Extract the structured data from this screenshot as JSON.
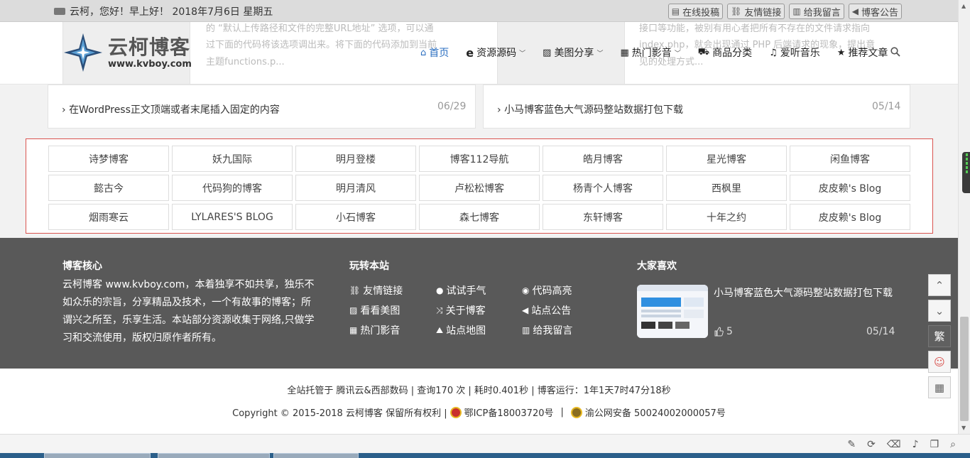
{
  "topbar": {
    "greeting": "云柯，您好！早上好！ 2018年7月6日 星期五",
    "links": [
      {
        "icon": "edit-icon",
        "glyph": "▤",
        "label": "在线投稿"
      },
      {
        "icon": "link-icon",
        "glyph": "⛓",
        "label": "友情链接"
      },
      {
        "icon": "book-icon",
        "glyph": "▥",
        "label": "给我留言"
      },
      {
        "icon": "speaker-icon",
        "glyph": "◀",
        "label": "博客公告"
      }
    ]
  },
  "header": {
    "logo_text": "云柯博客",
    "logo_url": "www.kvboy.com",
    "ghost_texts": [
      "的 “默认上传路径和文件的完整URL地址” 选项，可以通",
      "过下面的代码将该选项调出来。将下面的代码添加到当前",
      "主题functions.p...",
      "接口等功能，被别有用心者把所有不存在的文件请求指向",
      "index.php，就会出现通过 PHP 后端请求的现象，提出意",
      "见的处理方式..."
    ],
    "nav": [
      {
        "label": "首页",
        "icon": "home-icon",
        "glyph": "⌂",
        "caret": false,
        "active": true
      },
      {
        "label": "资源源码",
        "icon": "ie-icon",
        "glyph": "e",
        "caret": true,
        "active": false
      },
      {
        "label": "美图分享",
        "icon": "image-icon",
        "glyph": "▨",
        "caret": true,
        "active": false
      },
      {
        "label": "热门影音",
        "icon": "film-icon",
        "glyph": "▦",
        "caret": true,
        "active": false
      },
      {
        "label": "商品分类",
        "icon": "cart-icon",
        "glyph": "⛟",
        "caret": false,
        "active": false
      },
      {
        "label": "爱听音乐",
        "icon": "music-icon",
        "glyph": "♫",
        "caret": false,
        "active": false
      },
      {
        "label": "推荐文章",
        "icon": "star-icon",
        "glyph": "★",
        "caret": false,
        "active": false
      }
    ]
  },
  "posts": [
    {
      "title": "在WordPress正文顶端或者末尾插入固定的内容",
      "date": "06/29"
    },
    {
      "title": "小马博客蓝色大气源码整站数据打包下载",
      "date": "05/14"
    }
  ],
  "friend_links": [
    "诗梦博客",
    "妖九国际",
    "明月登楼",
    "博客112导航",
    "皓月博客",
    "星光博客",
    "闲鱼博客",
    "懿古今",
    "代码狗的博客",
    "明月清风",
    "卢松松博客",
    "杨青个人博客",
    "西枫里",
    "皮皮赖's Blog",
    "烟雨寒云",
    "LYLARES'S BLOG",
    "小石博客",
    "森七博客",
    "东轩博客",
    "十年之约",
    "皮皮赖's Blog"
  ],
  "footer": {
    "col1_title": "博客核心",
    "col1_text": "云柯博客 www.kvboy.com，本着独享不如共享，独乐不如众乐的宗旨，分享精品及技术，一个有故事的博客；所谓兴之所至，乐享生活。本站部分资源收集于网络,只做学习和交流使用，版权归原作者所有。",
    "col2_title": "玩转本站",
    "col2_links": [
      {
        "label": "友情链接",
        "icon": "link-icon",
        "glyph": "⛓"
      },
      {
        "label": "试试手气",
        "icon": "bomb-icon",
        "glyph": "●"
      },
      {
        "label": "代码高亮",
        "icon": "eye-icon",
        "glyph": "◉"
      },
      {
        "label": "看看美图",
        "icon": "image-icon",
        "glyph": "▨"
      },
      {
        "label": "关于博客",
        "icon": "random-icon",
        "glyph": "⤨"
      },
      {
        "label": "站点公告",
        "icon": "bullhorn-icon",
        "glyph": "◀"
      },
      {
        "label": "热门影音",
        "icon": "film-icon",
        "glyph": "▦"
      },
      {
        "label": "站点地图",
        "icon": "road-icon",
        "glyph": "⛰"
      },
      {
        "label": "给我留言",
        "icon": "book-icon",
        "glyph": "▥"
      }
    ],
    "col3_title": "大家喜欢",
    "fav_title": "小马博客蓝色大气源码整站数据打包下载",
    "fav_likes": "5",
    "fav_date": "05/14"
  },
  "bottom": {
    "stats": "全站托管于 腾讯云&西部数码 | 查询170 次 | 耗时0.401秒 | 博客运行：1年1天7时47分18秒",
    "copyright": "Copyright © 2015-2018  云柯博客  保留所有权利 |",
    "icp": "鄂ICP备18003720号",
    "sep": "|",
    "police": "渝公网安备 50024002000057号"
  },
  "side_buttons": {
    "up": "⌃",
    "down": "⌄",
    "traditional": "繁",
    "qq": "☺",
    "qr": "▦"
  },
  "tray_icons": [
    "pin-icon",
    "refresh-icon",
    "trash-icon",
    "volume-icon",
    "window-icon",
    "search-icon"
  ]
}
